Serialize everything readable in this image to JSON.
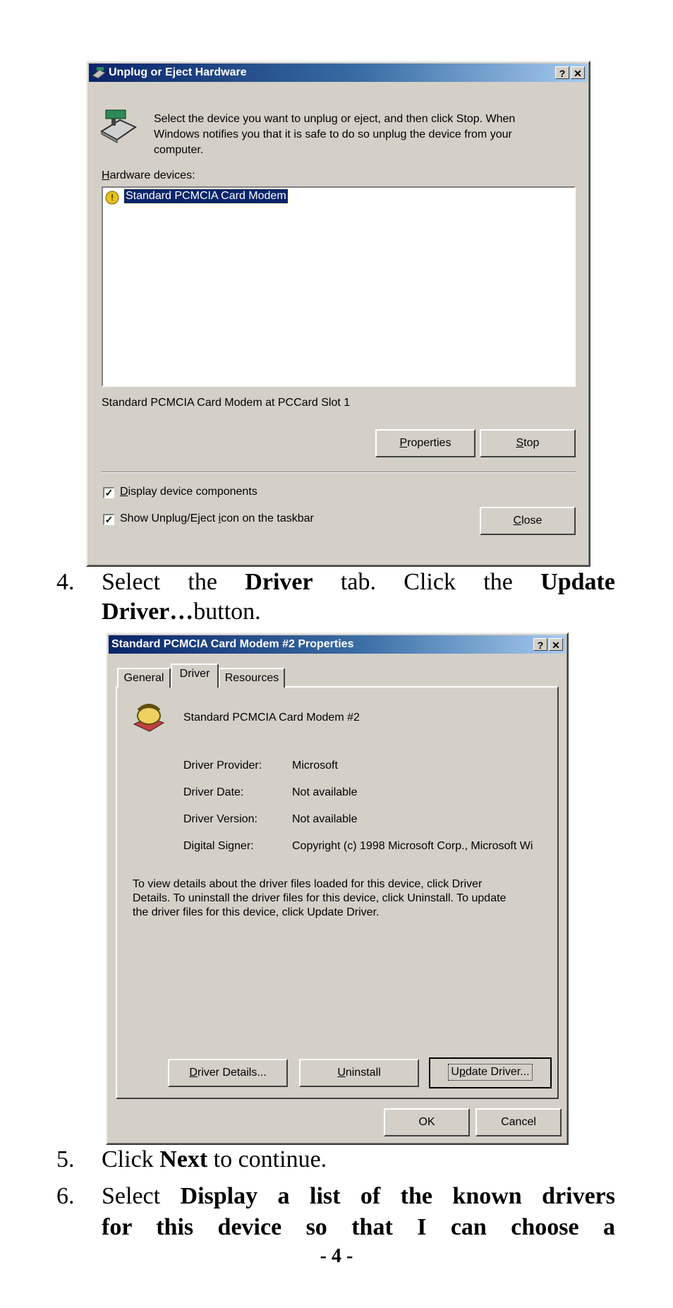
{
  "dialog1": {
    "title": "Unplug or Eject Hardware",
    "help_btn": "?",
    "close_btn": "✕",
    "intro_line1": "Select the device you want to unplug or eject, and then click Stop. When",
    "intro_line2": "Windows notifies you that it is safe to do so unplug the device from your",
    "intro_line3": "computer.",
    "devices_label_u": "H",
    "devices_label_rest": "ardware devices:",
    "device_item": "Standard PCMCIA Card Modem",
    "device_status": "Standard PCMCIA Card Modem at PCCard Slot 1",
    "properties_u": "P",
    "properties_rest": "roperties",
    "stop_u": "S",
    "stop_rest": "top",
    "chk1_u": "D",
    "chk1_rest": "isplay device components",
    "chk2_pre": "Show Unplug/Eject ",
    "chk2_u": "i",
    "chk2_rest": "con on the taskbar",
    "close_u": "C",
    "close_rest": "lose"
  },
  "step4": {
    "num": "4.",
    "t1": "Select the ",
    "b1": "Driver",
    "t2": " tab. Click the ",
    "b2": "Update",
    "b3": "Driver…",
    "t3": "button."
  },
  "dialog2": {
    "title": "Standard PCMCIA Card Modem #2 Properties",
    "help_btn": "?",
    "close_btn": "✕",
    "tabs": [
      "General",
      "Driver",
      "Resources"
    ],
    "device_name": "Standard PCMCIA Card Modem #2",
    "fields": [
      {
        "label": "Driver Provider:",
        "value": "Microsoft"
      },
      {
        "label": "Driver Date:",
        "value": "Not available"
      },
      {
        "label": "Driver Version:",
        "value": "Not available"
      },
      {
        "label": "Digital Signer:",
        "value": "Copyright (c) 1998 Microsoft Corp., Microsoft Wi"
      }
    ],
    "desc_line1": "To view details about the driver files loaded for this device, click Driver",
    "desc_line2": "Details. To uninstall the driver files for this device, click Uninstall. To update",
    "desc_line3": "the driver files for this device, click Update Driver.",
    "details_u": "D",
    "details_rest": "river Details...",
    "uninstall_u": "U",
    "uninstall_rest": "ninstall",
    "update_pre": "U",
    "update_u": "p",
    "update_rest": "date Driver...",
    "ok": "OK",
    "cancel": "Cancel"
  },
  "step5": {
    "num": "5.",
    "t1": "Click ",
    "b1": "Next",
    "t2": " to continue."
  },
  "step6": {
    "num": "6.",
    "t1": "Select ",
    "b1": "Display a list of the known drivers",
    "b2": "for this device so that I can choose a"
  },
  "page_number": "- 4 -"
}
